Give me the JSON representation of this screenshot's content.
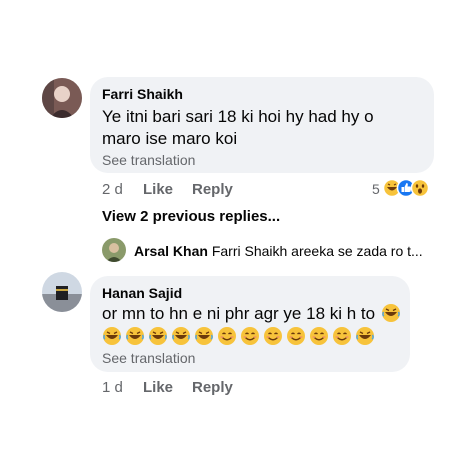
{
  "comments": [
    {
      "author": "Farri Shaikh",
      "text_line1": "Ye itni bari sari 18 ki hoi hy had hy o",
      "text_line2": "maro ise maro koi",
      "see_translation": "See translation",
      "time": "2 d",
      "like": "Like",
      "reply": "Reply",
      "reaction_count": "5",
      "reactions": [
        "laugh-react-icon",
        "like-react-icon",
        "wow-react-icon"
      ]
    },
    {
      "author": "Hanan Sajid",
      "text_line1": "or mn to hn e ni phr agr ye 18 ki h to",
      "see_translation": "See translation",
      "time": "1 d",
      "like": "Like",
      "reply": "Reply",
      "emoji_line": [
        "laugh",
        "laugh",
        "laugh",
        "laugh",
        "laugh",
        "smile",
        "smile",
        "smile",
        "smile",
        "smile",
        "smile",
        "laugh"
      ]
    }
  ],
  "view_previous": "View 2 previous replies...",
  "reply_preview": {
    "author": "Arsal Khan",
    "text": "Farri Shaikh areeka se zada ro t..."
  },
  "colors": {
    "bubble": "#f0f2f5",
    "secondary_text": "#65676b",
    "like_blue": "#1877f2",
    "emoji_yellow": "#f7c33b"
  }
}
